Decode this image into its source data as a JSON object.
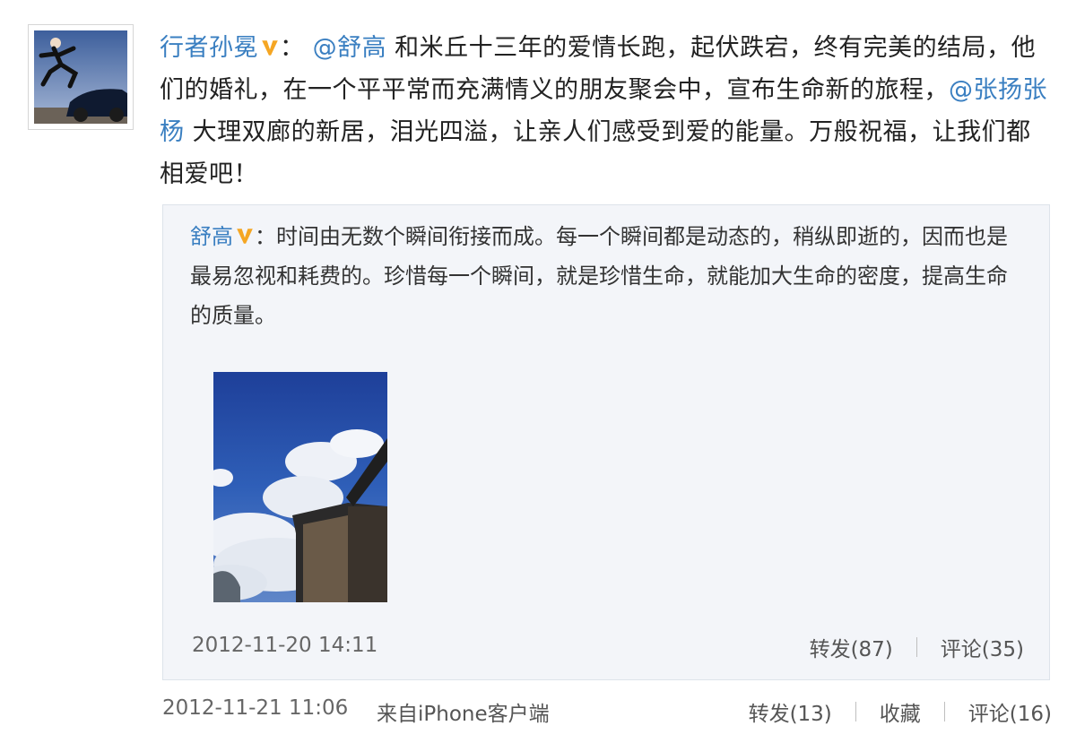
{
  "post": {
    "author": "行者孙冕",
    "colon": "：",
    "mention_1": "@舒高",
    "text_1": " 和米丘十三年的爱情长跑，起伏跌宕，终有完美的结局，他们的婚礼，在一个平平常而充满情义的朋友聚会中，宣布生命新的旅程，",
    "mention_2": "@张扬张杨",
    "text_2": " 大理双廊的新居，泪光四溢，让亲人们感受到爱的能量。万般祝福，让我们都相爱吧！",
    "time": "2012-11-21 11:06",
    "source": "来自iPhone客户端",
    "repost_label": "转发(13)",
    "favorite_label": "收藏",
    "comment_label": "评论(16)"
  },
  "quote": {
    "author": "舒高",
    "colon": "：",
    "text": "时间由无数个瞬间衔接而成。每一个瞬间都是动态的，稍纵即逝的，因而也是最易忽视和耗费的。珍惜每一个瞬间，就是珍惜生命，就能加大生命的密度，提高生命的质量。",
    "time": "2012-11-20 14:11",
    "repost_label": "转发(87)",
    "comment_label": "评论(35)"
  },
  "colors": {
    "link": "#3a7fc1",
    "badge": "#f5a623",
    "quote_bg": "#f3f5f9"
  },
  "icons": {
    "verified": "verified-v-icon"
  }
}
